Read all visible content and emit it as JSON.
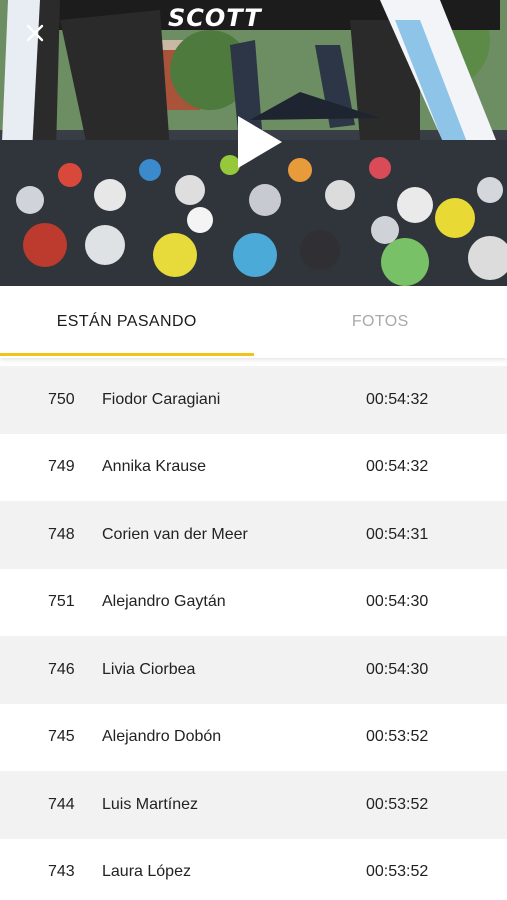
{
  "colors": {
    "tab_indicator": "#f0c419",
    "row_shade": "#f2f2f2"
  },
  "hero": {
    "banner_text": "SCOTT",
    "close_icon": "close-icon",
    "play_icon": "play-icon"
  },
  "tabs": [
    {
      "label": "ESTÁN PASANDO",
      "active": true
    },
    {
      "label": "FOTOS",
      "active": false
    }
  ],
  "riders": [
    {
      "number": "750",
      "name": "Fiodor Caragiani",
      "time": "00:54:32"
    },
    {
      "number": "749",
      "name": "Annika Krause",
      "time": "00:54:32"
    },
    {
      "number": "748",
      "name": "Corien van der Meer",
      "time": "00:54:31"
    },
    {
      "number": "751",
      "name": "Alejandro Gaytán",
      "time": "00:54:30"
    },
    {
      "number": "746",
      "name": "Livia Ciorbea",
      "time": "00:54:30"
    },
    {
      "number": "745",
      "name": "Alejandro Dobón",
      "time": "00:53:52"
    },
    {
      "number": "744",
      "name": "Luis Martínez",
      "time": "00:53:52"
    },
    {
      "number": "743",
      "name": "Laura López",
      "time": "00:53:52"
    }
  ]
}
